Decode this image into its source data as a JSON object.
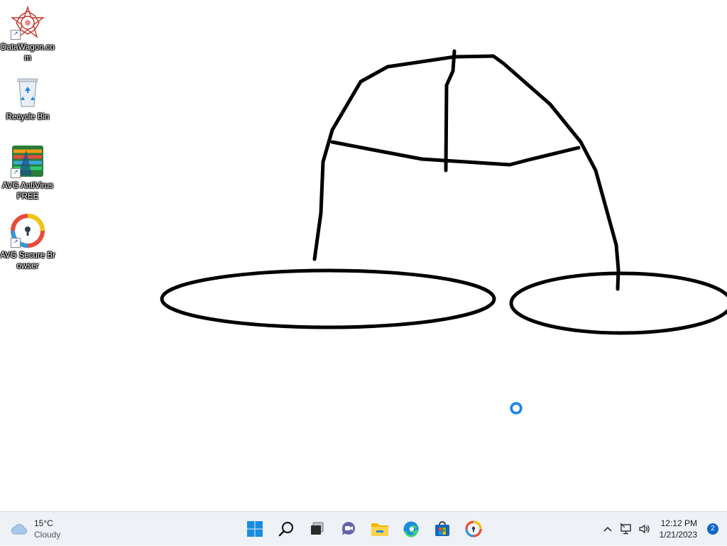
{
  "desktop": {
    "icons": [
      {
        "label": "DataWagon.com"
      },
      {
        "label": "Recycle Bin"
      },
      {
        "label": "AVG AntiVirus FREE"
      },
      {
        "label": "AVG Secure Browser"
      }
    ]
  },
  "taskbar": {
    "weather": {
      "temp": "15°C",
      "condition": "Cloudy"
    },
    "apps": [
      {
        "icon": "windows-start-icon"
      },
      {
        "icon": "search-icon"
      },
      {
        "icon": "task-view-icon"
      },
      {
        "icon": "teams-chat-icon"
      },
      {
        "icon": "file-explorer-icon"
      },
      {
        "icon": "edge-icon"
      },
      {
        "icon": "microsoft-store-icon"
      },
      {
        "icon": "avg-secure-browser-icon"
      }
    ],
    "tray": {
      "time": "12:12 PM",
      "date": "1/21/2023",
      "notifications": "2"
    }
  },
  "colors": {
    "taskbar_bg": "#eef1f6",
    "stroke": "#000000",
    "accent": "#1066c8"
  }
}
